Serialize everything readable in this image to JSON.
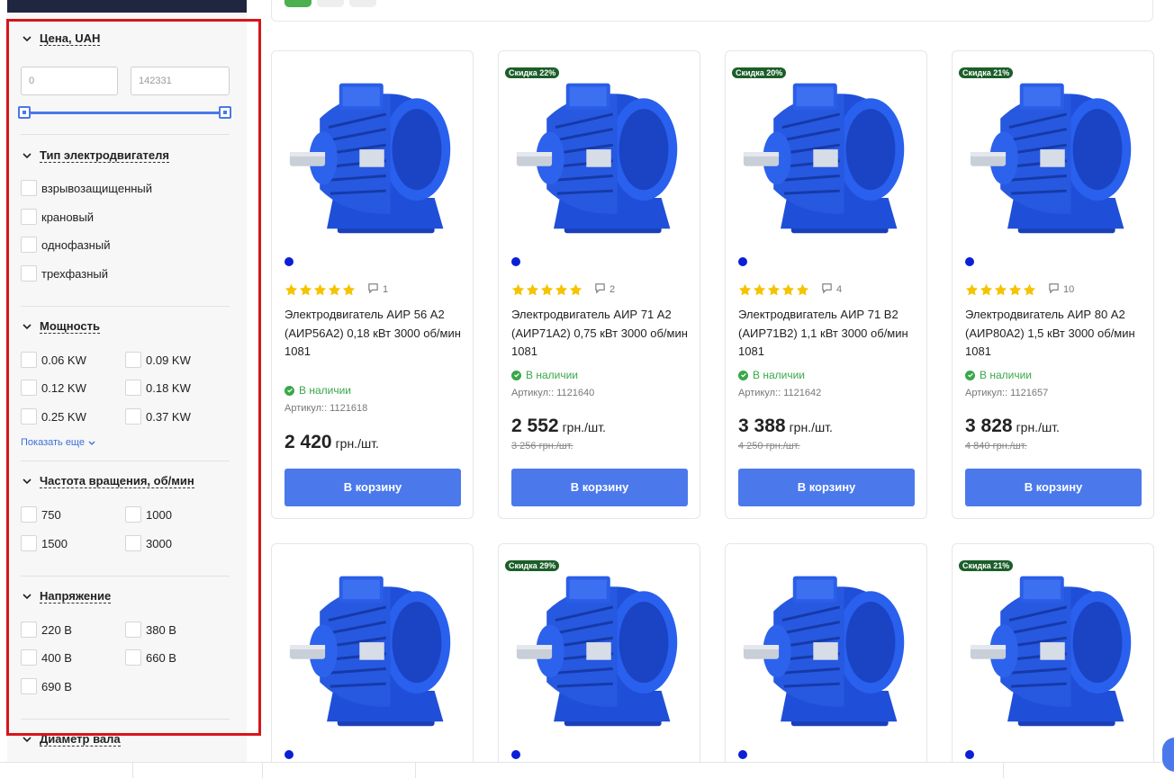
{
  "filters": {
    "price": {
      "title": "Цена, UAH",
      "min_placeholder": "0",
      "max_placeholder": "142331"
    },
    "motor_type": {
      "title": "Тип электродвигателя",
      "options": [
        "взрывозащищенный",
        "крановый",
        "однофазный",
        "трехфазный"
      ]
    },
    "power": {
      "title": "Мощность",
      "options": [
        "0.06 KW",
        "0.09 KW",
        "0.12 KW",
        "0.18 KW",
        "0.25 KW",
        "0.37 KW"
      ],
      "show_more": "Показать еще"
    },
    "speed": {
      "title": "Частота вращения, об/мин",
      "options": [
        "750",
        "1000",
        "1500",
        "3000"
      ]
    },
    "voltage": {
      "title": "Напряжение",
      "options": [
        "220 В",
        "380 В",
        "400 В",
        "660 В",
        "690 В"
      ]
    },
    "shaft": {
      "title": "Диаметр вала"
    }
  },
  "products": [
    {
      "badge": "",
      "rating": 5,
      "comments": "1",
      "name": "Электродвигатель АИР 56 А2 (АИР56А2) 0,18 кВт 3000 об/мин 1081",
      "stock": "В наличии",
      "sku": "Артикул:: 1121618",
      "price": "2 420",
      "unit": "грн./шт.",
      "old_price": "",
      "button": "В корзину"
    },
    {
      "badge": "Скидка 22%",
      "rating": 5,
      "comments": "2",
      "name": "Электродвигатель АИР 71 А2 (АИР71А2) 0,75 кВт 3000 об/мин 1081",
      "stock": "В наличии",
      "sku": "Артикул:: 1121640",
      "price": "2 552",
      "unit": "грн./шт.",
      "old_price": "3 256 грн./шт.",
      "button": "В корзину"
    },
    {
      "badge": "Скидка 20%",
      "rating": 5,
      "comments": "4",
      "name": "Электродвигатель АИР 71 В2 (АИР71В2) 1,1 кВт 3000 об/мин 1081",
      "stock": "В наличии",
      "sku": "Артикул:: 1121642",
      "price": "3 388",
      "unit": "грн./шт.",
      "old_price": "4 250 грн./шт.",
      "button": "В корзину"
    },
    {
      "badge": "Скидка 21%",
      "rating": 5,
      "comments": "10",
      "name": "Электродвигатель АИР 80 А2 (АИР80А2) 1,5 кВт 3000 об/мин 1081",
      "stock": "В наличии",
      "sku": "Артикул:: 1121657",
      "price": "3 828",
      "unit": "грн./шт.",
      "old_price": "4 840 грн./шт.",
      "button": "В корзину"
    }
  ],
  "products_row2": [
    {
      "badge": ""
    },
    {
      "badge": "Скидка 29%"
    },
    {
      "badge": ""
    },
    {
      "badge": "Скидка 21%"
    }
  ],
  "colors": {
    "accent": "#4b79ec",
    "badge": "#1b5e2a",
    "in_stock": "#3aa84a",
    "star": "#f5c400",
    "highlight": "#d6161c",
    "motor_blue": "#1f4fd8"
  },
  "icons": {
    "chevron": "chevron-down-icon",
    "comment": "comment-icon",
    "stock": "check-circle-icon",
    "star": "star-icon"
  }
}
